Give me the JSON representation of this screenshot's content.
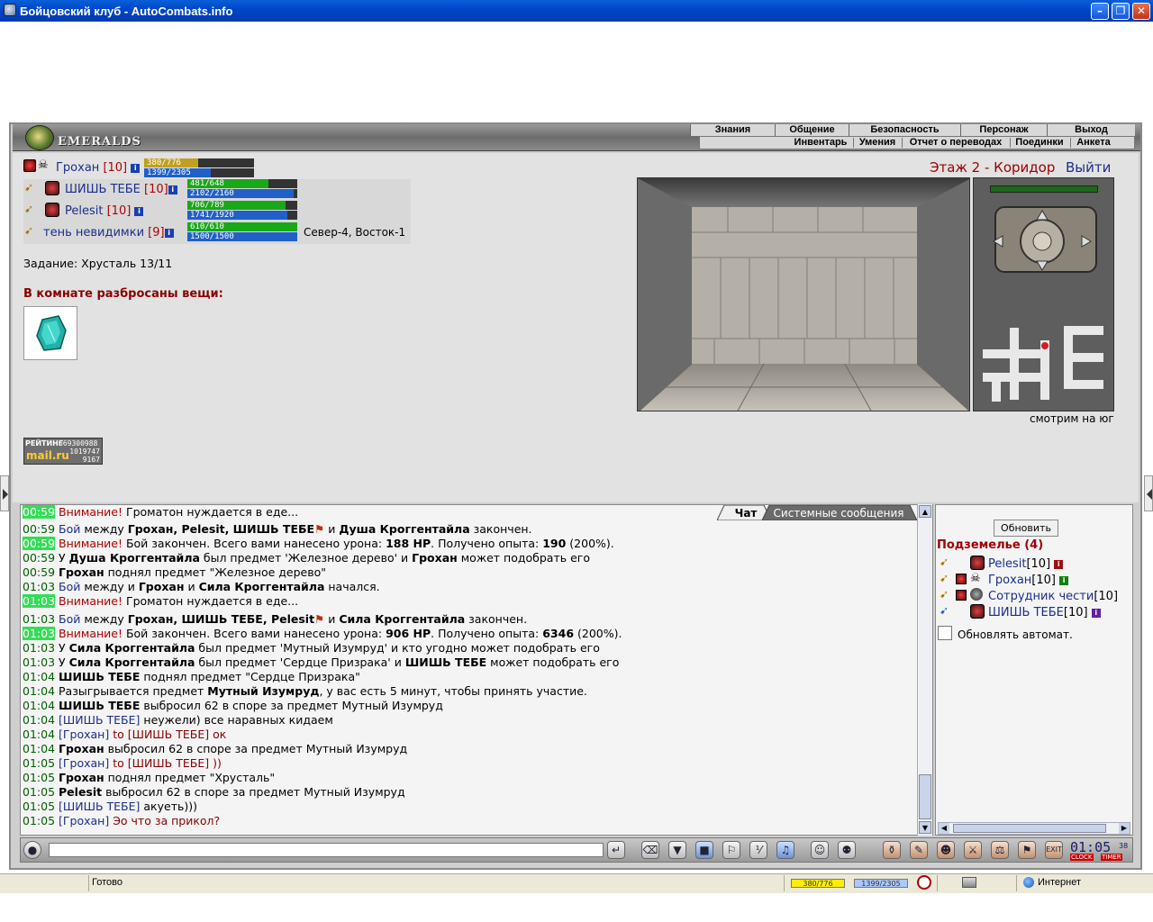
{
  "window": {
    "title": "Бойцовский клуб - AutoCombats.info"
  },
  "logo": {
    "text": "EMERALDS"
  },
  "menu": {
    "top": [
      "Знания",
      "Общение",
      "Безопасность",
      "Персонаж",
      "Выход"
    ],
    "sub": [
      "Инвентарь",
      "Умения",
      "Отчет о переводах",
      "Поединки",
      "Анкета"
    ]
  },
  "party": [
    {
      "name": "Грохан",
      "level": "[10]",
      "hp": "380/776",
      "mp": "1399/2305",
      "hp_frac": 0.49,
      "mp_frac": 0.61
    },
    {
      "name": "ШИШЬ ТЕБЕ",
      "level": "[10]",
      "hp": "481/648",
      "mp": "2102/2160",
      "hp_frac": 0.74,
      "mp_frac": 0.97
    },
    {
      "name": "Pelesit",
      "level": "[10]",
      "hp": "706/789",
      "mp": "1741/1920",
      "hp_frac": 0.89,
      "mp_frac": 0.91
    },
    {
      "name": "тень невидимки",
      "level": "[9]",
      "hp": "610/610",
      "mp": "1500/1500",
      "hp_frac": 1.0,
      "mp_frac": 1.0,
      "coords": "Север-4, Восток-1"
    }
  ],
  "task": "Задание: Хрусталь 13/11",
  "room_items_label": "В комнате разбросаны вещи:",
  "rating": {
    "label": "РЕЙТИНГ",
    "n1": "669300988",
    "brand": "mail.ru",
    "n2": "1019747",
    "n3": "9167"
  },
  "location": {
    "floor": "Этаж 2 - Коридор",
    "exit": "Выйти",
    "facing": "смотрим на юг"
  },
  "chat": {
    "tabs": [
      "Чат",
      "Системные сообщения"
    ],
    "lines": [
      {
        "time": "00:59",
        "hl": true,
        "parts": [
          [
            "w",
            "Внимание! "
          ],
          [
            "",
            "Громатон нуждается в еде..."
          ]
        ]
      },
      {
        "time": "00:59",
        "hl": false,
        "parts": [
          [
            "bl",
            "Бой "
          ],
          [
            "",
            "между "
          ],
          [
            "b",
            "Грохан, Pelesit, ШИШЬ ТЕБЕ"
          ],
          [
            "flag",
            ""
          ],
          [
            "",
            ""
          ],
          [
            "",
            " и "
          ],
          [
            "b",
            "Душа Кроггентайла"
          ],
          [
            "",
            " закончен."
          ]
        ]
      },
      {
        "time": "00:59",
        "hl": true,
        "parts": [
          [
            "w",
            "Внимание! "
          ],
          [
            "",
            "Бой закончен. Всего вами нанесено урона: "
          ],
          [
            "b",
            "188 HP"
          ],
          [
            "",
            ". Получено опыта: "
          ],
          [
            "b",
            "190"
          ],
          [
            "",
            " (200%)."
          ]
        ]
      },
      {
        "time": "00:59",
        "hl": false,
        "parts": [
          [
            "",
            "У "
          ],
          [
            "b",
            "Душа Кроггентайла"
          ],
          [
            "",
            " был предмет 'Железное дерево' и "
          ],
          [
            "b",
            "Грохан"
          ],
          [
            "",
            " может подобрать его"
          ]
        ]
      },
      {
        "time": "00:59",
        "hl": false,
        "parts": [
          [
            "b",
            "Грохан"
          ],
          [
            "",
            " поднял предмет \"Железное дерево\""
          ]
        ]
      },
      {
        "time": "01:03",
        "hl": false,
        "parts": [
          [
            "bl",
            "Бой "
          ],
          [
            "",
            "между и "
          ],
          [
            "b",
            "Грохан"
          ],
          [
            "",
            " и "
          ],
          [
            "b",
            "Сила Кроггентайла"
          ],
          [
            "",
            " начался."
          ]
        ]
      },
      {
        "time": "01:03",
        "hl": true,
        "parts": [
          [
            "w",
            "Внимание! "
          ],
          [
            "",
            "Громатон нуждается в еде..."
          ]
        ]
      },
      {
        "time": "01:03",
        "hl": false,
        "parts": [
          [
            "bl",
            "Бой "
          ],
          [
            "",
            "между "
          ],
          [
            "b",
            "Грохан, ШИШЬ ТЕБЕ, Pelesit"
          ],
          [
            "flag",
            ""
          ],
          [
            "",
            " и "
          ],
          [
            "b",
            "Сила Кроггентайла"
          ],
          [
            "",
            " закончен."
          ]
        ]
      },
      {
        "time": "01:03",
        "hl": true,
        "parts": [
          [
            "w",
            "Внимание! "
          ],
          [
            "",
            "Бой закончен. Всего вами нанесено урона: "
          ],
          [
            "b",
            "906 HP"
          ],
          [
            "",
            ". Получено опыта: "
          ],
          [
            "b",
            "6346"
          ],
          [
            "",
            " (200%)."
          ]
        ]
      },
      {
        "time": "01:03",
        "hl": false,
        "parts": [
          [
            "",
            "У "
          ],
          [
            "b",
            "Сила Кроггентайла"
          ],
          [
            "",
            " был предмет 'Мутный Изумруд' и кто угодно может подобрать его"
          ]
        ]
      },
      {
        "time": "01:03",
        "hl": false,
        "parts": [
          [
            "",
            "У "
          ],
          [
            "b",
            "Сила Кроггентайла"
          ],
          [
            "",
            " был предмет 'Сердце Призрака' и "
          ],
          [
            "b",
            "ШИШЬ ТЕБЕ"
          ],
          [
            "",
            " может подобрать его"
          ]
        ]
      },
      {
        "time": "01:04",
        "hl": false,
        "parts": [
          [
            "b",
            "ШИШЬ ТЕБЕ"
          ],
          [
            "",
            " поднял предмет \"Сердце Призрака\""
          ]
        ]
      },
      {
        "time": "01:04",
        "hl": false,
        "parts": [
          [
            "",
            "Разыгрывается предмет "
          ],
          [
            "b",
            "Мутный Изумруд"
          ],
          [
            "",
            ", у вас есть 5 минут, чтобы принять участие."
          ]
        ]
      },
      {
        "time": "01:04",
        "hl": false,
        "parts": [
          [
            "b",
            "ШИШЬ ТЕБЕ"
          ],
          [
            "",
            " выбросил 62 в споре за предмет Мутный Изумруд"
          ]
        ]
      },
      {
        "time": "01:04",
        "hl": false,
        "parts": [
          [
            "bl",
            "[ШИШЬ ТЕБЕ]"
          ],
          [
            "",
            " неужели) все наравных кидаем"
          ]
        ]
      },
      {
        "time": "01:04",
        "hl": false,
        "parts": [
          [
            "bl",
            "[Грохан]"
          ],
          [
            "dr",
            " to [ШИШЬ ТЕБЕ] ок"
          ]
        ]
      },
      {
        "time": "01:04",
        "hl": false,
        "parts": [
          [
            "b",
            "Грохан"
          ],
          [
            "",
            " выбросил 62 в споре за предмет Мутный Изумруд"
          ]
        ]
      },
      {
        "time": "01:05",
        "hl": false,
        "parts": [
          [
            "bl",
            "[Грохан]"
          ],
          [
            "dr",
            " to [ШИШЬ ТЕБЕ] ))"
          ]
        ]
      },
      {
        "time": "01:05",
        "hl": false,
        "parts": [
          [
            "b",
            "Грохан"
          ],
          [
            "",
            " поднял предмет \"Хрусталь\""
          ]
        ]
      },
      {
        "time": "01:05",
        "hl": false,
        "parts": [
          [
            "b",
            "Pelesit"
          ],
          [
            "",
            " выбросил 62 в споре за предмет Мутный Изумруд"
          ]
        ]
      },
      {
        "time": "01:05",
        "hl": false,
        "parts": [
          [
            "bl",
            "[ШИШЬ ТЕБЕ]"
          ],
          [
            "",
            " акуеть)))"
          ]
        ]
      },
      {
        "time": "01:05",
        "hl": false,
        "parts": [
          [
            "bl",
            "[Грохан]"
          ],
          [
            "dr",
            " Эо что за прикол?"
          ]
        ]
      }
    ]
  },
  "side": {
    "refresh": "Обновить",
    "title": "Подземелье (4)",
    "members": [
      {
        "name": "Pelesit",
        "level": "[10]"
      },
      {
        "name": "Грохан",
        "level": "[10]"
      },
      {
        "name": "Сотрудник чести",
        "level": "[10]"
      },
      {
        "name": "ШИШЬ ТЕБЕ",
        "level": "[10]"
      }
    ],
    "auto_refresh": "Обновлять автомат."
  },
  "clock": {
    "time": "01:05",
    "sec": "38",
    "clock_label": "CLOCK",
    "timer_label": "TIMER"
  },
  "statusbar": {
    "ready": "Готово",
    "hp": "380/776",
    "mp": "1399/2305",
    "zone": "Интернет"
  },
  "colors": {
    "accent": "#0047c8",
    "hp": "#18a818",
    "mp": "#2060c8",
    "highlight": "#33dd55"
  }
}
